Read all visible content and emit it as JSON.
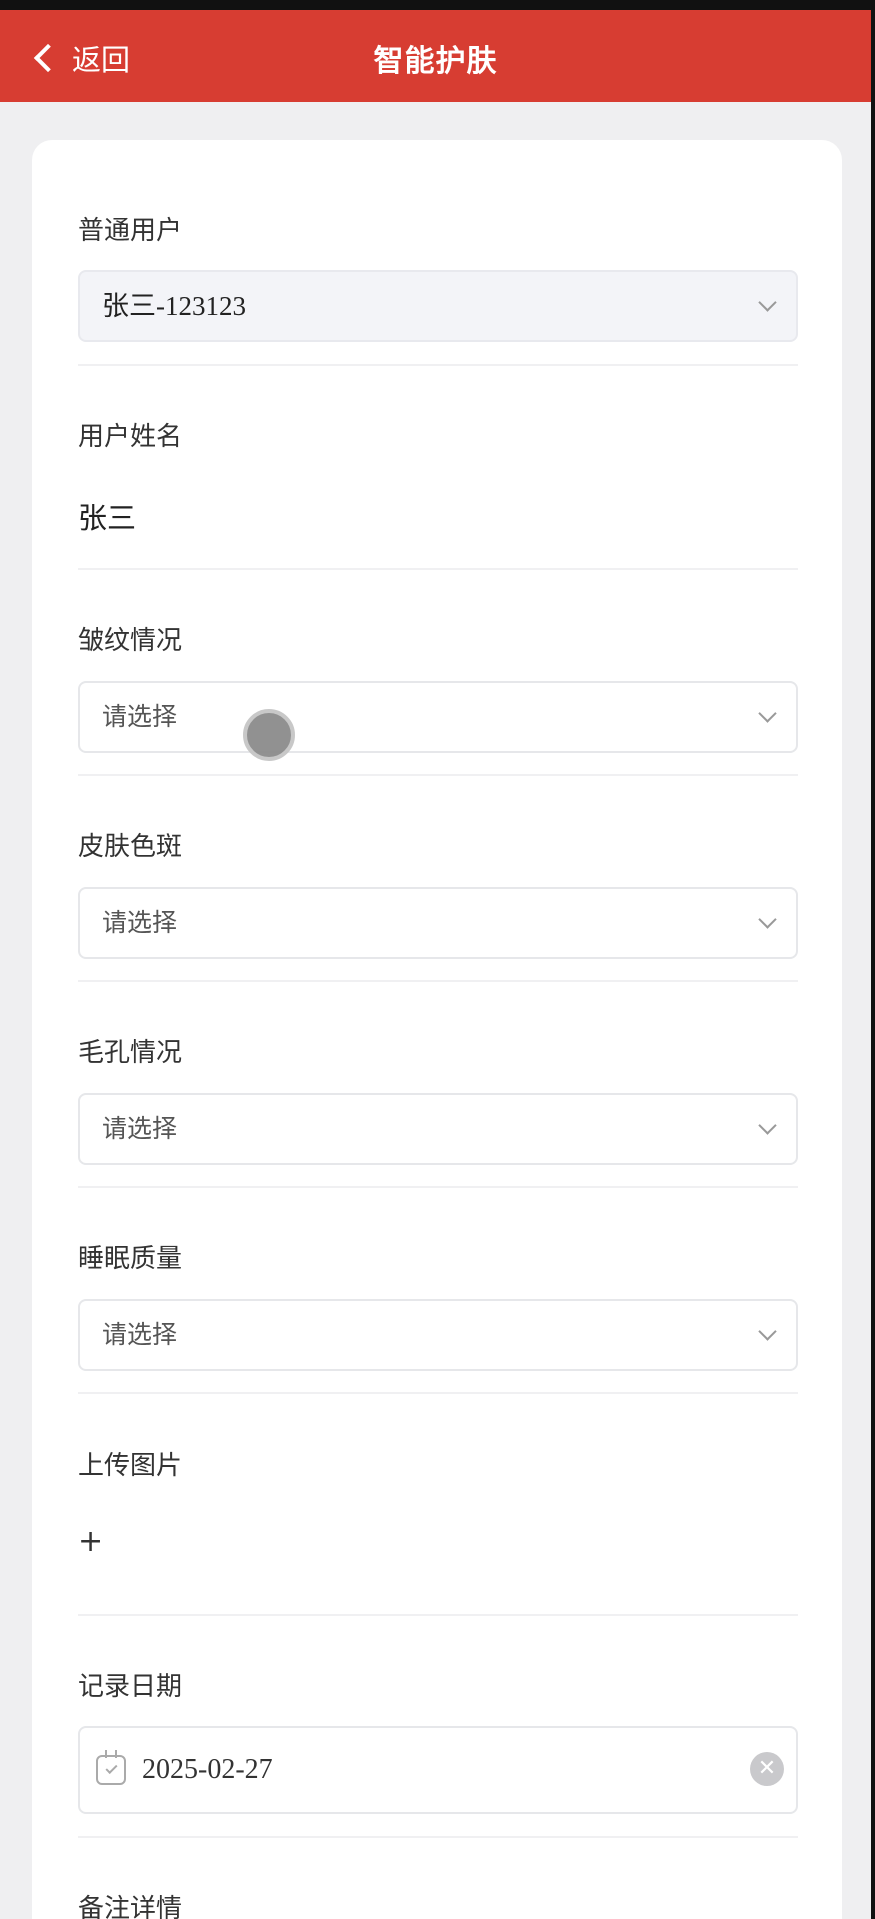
{
  "nav": {
    "back_label": "返回",
    "title": "智能护肤"
  },
  "form": {
    "user_type": {
      "label": "普通用户",
      "value": "张三-123123"
    },
    "user_name": {
      "label": "用户姓名",
      "value": "张三"
    },
    "wrinkles": {
      "label": "皱纹情况",
      "placeholder": "请选择"
    },
    "spots": {
      "label": "皮肤色斑",
      "placeholder": "请选择"
    },
    "pores": {
      "label": "毛孔情况",
      "placeholder": "请选择"
    },
    "sleep": {
      "label": "睡眠质量",
      "placeholder": "请选择"
    },
    "upload": {
      "label": "上传图片",
      "add": "+"
    },
    "record_date": {
      "label": "记录日期",
      "value": "2025-02-27"
    },
    "remarks": {
      "label": "备注详情"
    }
  },
  "colors": {
    "header": "#d73d32",
    "background": "#efeff1"
  },
  "icons": {
    "back": "chevron-left-icon",
    "dropdown": "chevron-down-icon",
    "calendar": "calendar-icon",
    "clear": "clear-icon"
  }
}
